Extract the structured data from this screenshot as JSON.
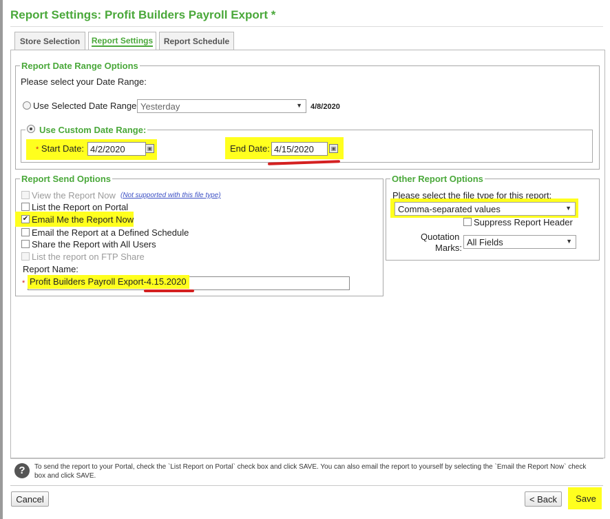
{
  "title": "Report Settings: Profit Builders Payroll Export *",
  "tabs": [
    {
      "label": "Store Selection"
    },
    {
      "label": "Report Settings"
    },
    {
      "label": "Report Schedule"
    }
  ],
  "date_range": {
    "legend": "Report Date Range Options",
    "prompt": "Please select your Date Range:",
    "selected_label": "Use Selected Date Range:",
    "selected_value": "Yesterday",
    "selected_date": "4/8/2020",
    "custom_legend": "Use Custom Date Range:",
    "start_label": "Start Date:",
    "start_value": "4/2/2020",
    "end_label": "End Date:",
    "end_value": "4/15/2020",
    "required_mark": "*"
  },
  "send_options": {
    "legend": "Report Send Options",
    "view_now": "View the Report Now",
    "not_supported": "(Not supported with this file type)",
    "list_portal": "List the Report on Portal",
    "email_now": "Email Me the Report Now",
    "email_schedule": "Email the Report at a Defined Schedule",
    "share_all": "Share the Report with All Users",
    "list_ftp": "List the report on FTP Share",
    "report_name_label": "Report Name:",
    "report_name_value": "Profit Builders Payroll Export-4.15.2020"
  },
  "other_options": {
    "legend": "Other Report Options",
    "file_type_prompt": "Please select the file type for this report:",
    "file_type_value": "Comma-separated values",
    "suppress_header": "Suppress Report Header",
    "quotation_label_1": "Quotation",
    "quotation_label_2": "Marks:",
    "quotation_value": "All Fields"
  },
  "help": {
    "icon": "question-icon",
    "text": "To send the report to your Portal, check the `List Report on Portal` check box and click SAVE. You can also email the report to yourself by selecting the `Email the Report Now` check box and click SAVE."
  },
  "buttons": {
    "cancel": "Cancel",
    "back": "< Back",
    "save": "Save"
  },
  "colors": {
    "accent": "#4aa83a",
    "highlight": "#ffff1e",
    "annotation_red": "#d42020"
  }
}
